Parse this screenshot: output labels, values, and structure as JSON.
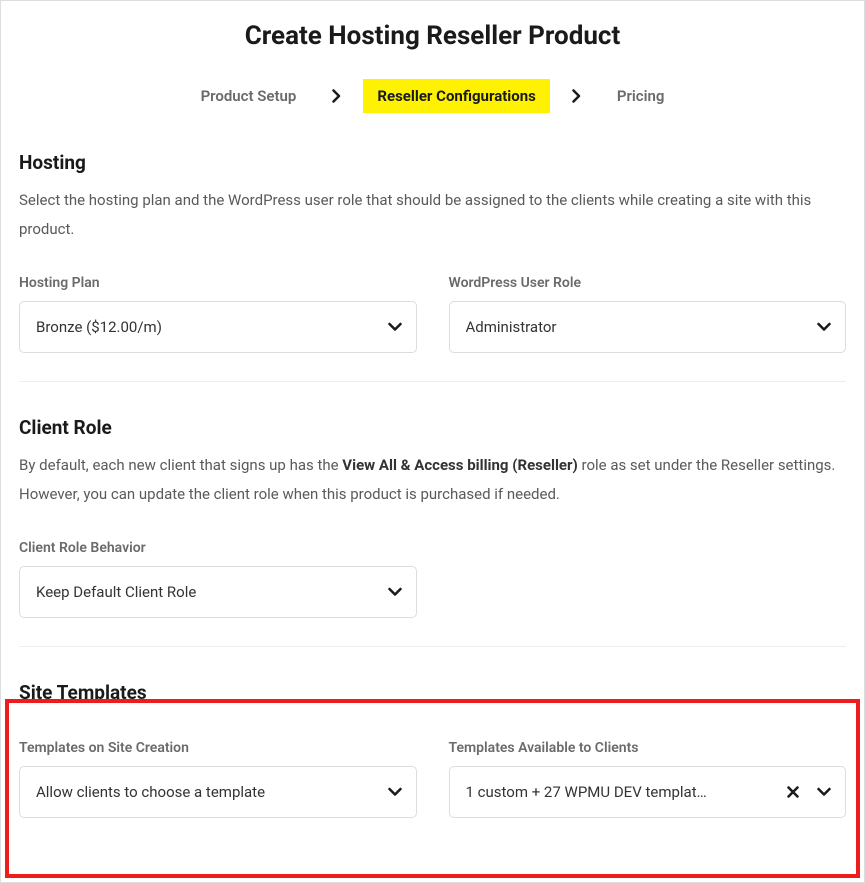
{
  "page_title": "Create Hosting Reseller Product",
  "tabs": {
    "product_setup": "Product Setup",
    "reseller_configs": "Reseller Configurations",
    "pricing": "Pricing"
  },
  "hosting": {
    "title": "Hosting",
    "desc": "Select the hosting plan and the WordPress user role that should be assigned to the clients while creating a site with this product.",
    "plan_label": "Hosting Plan",
    "plan_value": "Bronze ($12.00/m)",
    "role_label": "WordPress User Role",
    "role_value": "Administrator"
  },
  "client_role": {
    "title": "Client Role",
    "desc_prefix": "By default, each new client that signs up has the ",
    "desc_bold": "View All & Access billing (Reseller)",
    "desc_suffix": " role as set under the Reseller settings. However, you can update the client role when this product is purchased if needed.",
    "behavior_label": "Client Role Behavior",
    "behavior_value": "Keep Default Client Role"
  },
  "site_templates": {
    "title": "Site Templates",
    "on_creation_label": "Templates on Site Creation",
    "on_creation_value": "Allow clients to choose a template",
    "available_label": "Templates Available to Clients",
    "available_value": "1 custom + 27 WPMU DEV templat…"
  }
}
